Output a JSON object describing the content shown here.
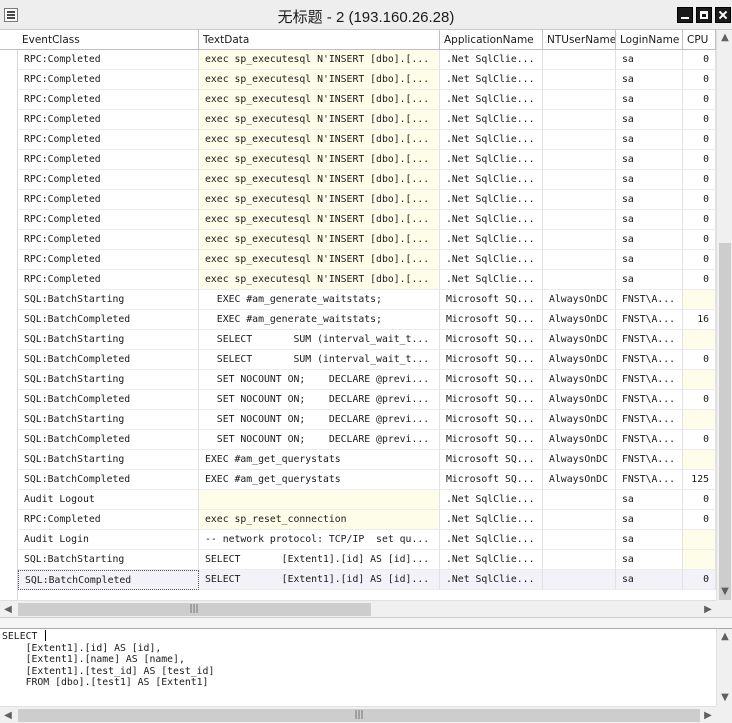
{
  "window": {
    "title": "无标题 - 2 (193.160.26.28)"
  },
  "columns": [
    {
      "key": "event_class",
      "label": "EventClass"
    },
    {
      "key": "text_data",
      "label": "TextData"
    },
    {
      "key": "application_name",
      "label": "ApplicationName"
    },
    {
      "key": "nt_user_name",
      "label": "NTUserName"
    },
    {
      "key": "login_name",
      "label": "LoginName"
    },
    {
      "key": "cpu",
      "label": "CPU"
    }
  ],
  "rows": [
    {
      "event_class": "RPC:Completed",
      "text_data": "exec sp_executesql N'INSERT [dbo].[...",
      "application_name": ".Net SqlClie...",
      "nt_user_name": "",
      "login_name": "sa",
      "cpu": "0"
    },
    {
      "event_class": "RPC:Completed",
      "text_data": "exec sp_executesql N'INSERT [dbo].[...",
      "application_name": ".Net SqlClie...",
      "nt_user_name": "",
      "login_name": "sa",
      "cpu": "0"
    },
    {
      "event_class": "RPC:Completed",
      "text_data": "exec sp_executesql N'INSERT [dbo].[...",
      "application_name": ".Net SqlClie...",
      "nt_user_name": "",
      "login_name": "sa",
      "cpu": "0"
    },
    {
      "event_class": "RPC:Completed",
      "text_data": "exec sp_executesql N'INSERT [dbo].[...",
      "application_name": ".Net SqlClie...",
      "nt_user_name": "",
      "login_name": "sa",
      "cpu": "0"
    },
    {
      "event_class": "RPC:Completed",
      "text_data": "exec sp_executesql N'INSERT [dbo].[...",
      "application_name": ".Net SqlClie...",
      "nt_user_name": "",
      "login_name": "sa",
      "cpu": "0"
    },
    {
      "event_class": "RPC:Completed",
      "text_data": "exec sp_executesql N'INSERT [dbo].[...",
      "application_name": ".Net SqlClie...",
      "nt_user_name": "",
      "login_name": "sa",
      "cpu": "0"
    },
    {
      "event_class": "RPC:Completed",
      "text_data": "exec sp_executesql N'INSERT [dbo].[...",
      "application_name": ".Net SqlClie...",
      "nt_user_name": "",
      "login_name": "sa",
      "cpu": "0"
    },
    {
      "event_class": "RPC:Completed",
      "text_data": "exec sp_executesql N'INSERT [dbo].[...",
      "application_name": ".Net SqlClie...",
      "nt_user_name": "",
      "login_name": "sa",
      "cpu": "0"
    },
    {
      "event_class": "RPC:Completed",
      "text_data": "exec sp_executesql N'INSERT [dbo].[...",
      "application_name": ".Net SqlClie...",
      "nt_user_name": "",
      "login_name": "sa",
      "cpu": "0"
    },
    {
      "event_class": "RPC:Completed",
      "text_data": "exec sp_executesql N'INSERT [dbo].[...",
      "application_name": ".Net SqlClie...",
      "nt_user_name": "",
      "login_name": "sa",
      "cpu": "0"
    },
    {
      "event_class": "RPC:Completed",
      "text_data": "exec sp_executesql N'INSERT [dbo].[...",
      "application_name": ".Net SqlClie...",
      "nt_user_name": "",
      "login_name": "sa",
      "cpu": "0"
    },
    {
      "event_class": "RPC:Completed",
      "text_data": "exec sp_executesql N'INSERT [dbo].[...",
      "application_name": ".Net SqlClie...",
      "nt_user_name": "",
      "login_name": "sa",
      "cpu": "0"
    },
    {
      "event_class": "SQL:BatchStarting",
      "text_data": "  EXEC #am_generate_waitstats;",
      "application_name": "Microsoft SQ...",
      "nt_user_name": "AlwaysOnDC",
      "login_name": "FNST\\A...",
      "cpu": ""
    },
    {
      "event_class": "SQL:BatchCompleted",
      "text_data": "  EXEC #am_generate_waitstats;",
      "application_name": "Microsoft SQ...",
      "nt_user_name": "AlwaysOnDC",
      "login_name": "FNST\\A...",
      "cpu": "16"
    },
    {
      "event_class": "SQL:BatchStarting",
      "text_data": "  SELECT       SUM (interval_wait_t...",
      "application_name": "Microsoft SQ...",
      "nt_user_name": "AlwaysOnDC",
      "login_name": "FNST\\A...",
      "cpu": ""
    },
    {
      "event_class": "SQL:BatchCompleted",
      "text_data": "  SELECT       SUM (interval_wait_t...",
      "application_name": "Microsoft SQ...",
      "nt_user_name": "AlwaysOnDC",
      "login_name": "FNST\\A...",
      "cpu": "0"
    },
    {
      "event_class": "SQL:BatchStarting",
      "text_data": "  SET NOCOUNT ON;    DECLARE @previ...",
      "application_name": "Microsoft SQ...",
      "nt_user_name": "AlwaysOnDC",
      "login_name": "FNST\\A...",
      "cpu": ""
    },
    {
      "event_class": "SQL:BatchCompleted",
      "text_data": "  SET NOCOUNT ON;    DECLARE @previ...",
      "application_name": "Microsoft SQ...",
      "nt_user_name": "AlwaysOnDC",
      "login_name": "FNST\\A...",
      "cpu": "0"
    },
    {
      "event_class": "SQL:BatchStarting",
      "text_data": "  SET NOCOUNT ON;    DECLARE @previ...",
      "application_name": "Microsoft SQ...",
      "nt_user_name": "AlwaysOnDC",
      "login_name": "FNST\\A...",
      "cpu": ""
    },
    {
      "event_class": "SQL:BatchCompleted",
      "text_data": "  SET NOCOUNT ON;    DECLARE @previ...",
      "application_name": "Microsoft SQ...",
      "nt_user_name": "AlwaysOnDC",
      "login_name": "FNST\\A...",
      "cpu": "0"
    },
    {
      "event_class": "SQL:BatchStarting",
      "text_data": "EXEC #am_get_querystats",
      "application_name": "Microsoft SQ...",
      "nt_user_name": "AlwaysOnDC",
      "login_name": "FNST\\A...",
      "cpu": ""
    },
    {
      "event_class": "SQL:BatchCompleted",
      "text_data": "EXEC #am_get_querystats",
      "application_name": "Microsoft SQ...",
      "nt_user_name": "AlwaysOnDC",
      "login_name": "FNST\\A...",
      "cpu": "125"
    },
    {
      "event_class": "Audit Logout",
      "text_data": "",
      "application_name": ".Net SqlClie...",
      "nt_user_name": "",
      "login_name": "sa",
      "cpu": "0"
    },
    {
      "event_class": "RPC:Completed",
      "text_data": "exec sp_reset_connection",
      "application_name": ".Net SqlClie...",
      "nt_user_name": "",
      "login_name": "sa",
      "cpu": "0"
    },
    {
      "event_class": "Audit Login",
      "text_data": "-- network protocol: TCP/IP  set qu...",
      "application_name": ".Net SqlClie...",
      "nt_user_name": "",
      "login_name": "sa",
      "cpu": ""
    },
    {
      "event_class": "SQL:BatchStarting",
      "text_data": "SELECT       [Extent1].[id] AS [id]...",
      "application_name": ".Net SqlClie...",
      "nt_user_name": "",
      "login_name": "sa",
      "cpu": ""
    },
    {
      "event_class": "SQL:BatchCompleted",
      "text_data": "SELECT       [Extent1].[id] AS [id]...",
      "application_name": ".Net SqlClie...",
      "nt_user_name": "",
      "login_name": "sa",
      "cpu": "0",
      "selected": true
    }
  ],
  "detail": {
    "text": "SELECT \n    [Extent1].[id] AS [id],\n    [Extent1].[name] AS [name],\n    [Extent1].[test_id] AS [test_id]\n    FROM [dbo].[test1] AS [Extent1]"
  },
  "icons": {
    "app": "app-window-icon",
    "minimize": "minimize-icon",
    "maximize": "maximize-icon",
    "close": "close-icon",
    "scroll_up": "arrow-up-icon",
    "scroll_down": "arrow-down-icon",
    "scroll_left": "arrow-left-icon",
    "scroll_right": "arrow-right-icon",
    "grip": "scroll-grip-icon"
  }
}
